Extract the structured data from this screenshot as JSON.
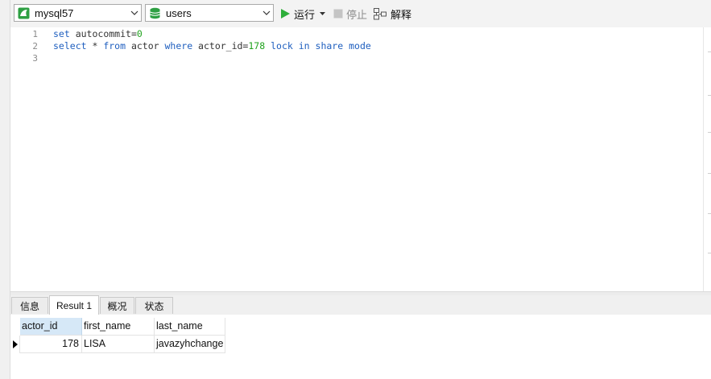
{
  "toolbar": {
    "connection": {
      "value": "mysql57",
      "icon": "mysql-connection-icon"
    },
    "database": {
      "value": "users",
      "icon": "database-icon"
    },
    "run_label": "运行",
    "stop_label": "停止",
    "explain_label": "解释"
  },
  "editor": {
    "line_numbers": [
      "1",
      "2",
      "3"
    ],
    "lines": [
      {
        "tokens": [
          {
            "text": "set",
            "kind": "kw"
          },
          {
            "text": " autocommit=",
            "kind": "id"
          },
          {
            "text": "0",
            "kind": "num"
          }
        ]
      },
      {
        "tokens": [
          {
            "text": "select",
            "kind": "kw"
          },
          {
            "text": " * ",
            "kind": "id"
          },
          {
            "text": "from",
            "kind": "kw"
          },
          {
            "text": " actor ",
            "kind": "id"
          },
          {
            "text": "where",
            "kind": "kw"
          },
          {
            "text": " actor_id=",
            "kind": "id"
          },
          {
            "text": "178",
            "kind": "num"
          },
          {
            "text": " ",
            "kind": "id"
          },
          {
            "text": "lock",
            "kind": "kw"
          },
          {
            "text": " ",
            "kind": "id"
          },
          {
            "text": "in",
            "kind": "kw"
          },
          {
            "text": " ",
            "kind": "id"
          },
          {
            "text": "share",
            "kind": "kw"
          },
          {
            "text": " ",
            "kind": "id"
          },
          {
            "text": "mode",
            "kind": "kw"
          }
        ]
      },
      {
        "tokens": []
      }
    ]
  },
  "tabs": [
    {
      "label": "信息",
      "active": false
    },
    {
      "label": "Result 1",
      "active": true
    },
    {
      "label": "概况",
      "active": false
    },
    {
      "label": "状态",
      "active": false
    }
  ],
  "results": {
    "columns": [
      "actor_id",
      "first_name",
      "last_name"
    ],
    "rows": [
      [
        "178",
        "LISA",
        "javazyhchange"
      ]
    ]
  },
  "colors": {
    "keyword": "#1f5fbf",
    "number": "#22a31f",
    "run_green": "#2eae3a",
    "selected_header": "#d6e8f7"
  }
}
